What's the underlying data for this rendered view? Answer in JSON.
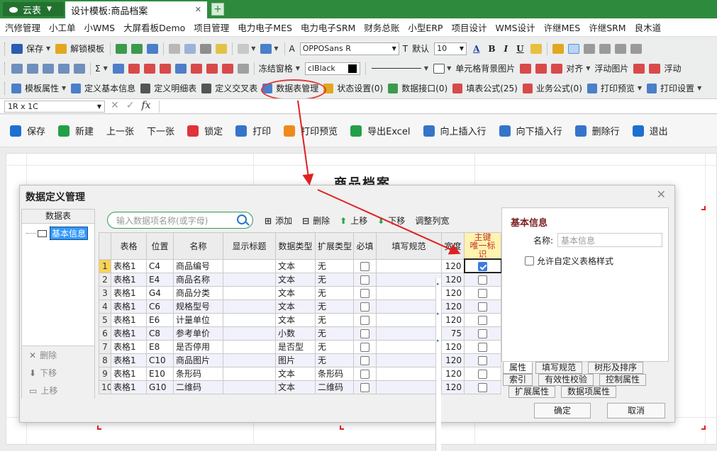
{
  "app": {
    "name": "云表",
    "doc_tab": "设计模板:商品档案"
  },
  "menu": [
    "汽修管理",
    "小工单",
    "小WMS",
    "大屏看板Demo",
    "项目管理",
    "电力电子MES",
    "电力电子SRM",
    "财务总账",
    "小型ERP",
    "项目设计",
    "WMS设计",
    "许继MES",
    "许继SRM",
    "良木道"
  ],
  "toolbar1": {
    "save": "保存",
    "unlock": "解锁模板",
    "font": "OPPOSans R",
    "theme": "默认",
    "size": "10"
  },
  "toolbar2": {
    "freeze": "冻结窗格",
    "color": "clBlack",
    "cell_bg": "单元格背景图片",
    "align": "对齐",
    "float_img": "浮动图片",
    "float2": "浮动"
  },
  "toolbar3": [
    "模板属性",
    "定义基本信息",
    "定义明细表",
    "定义交叉表",
    "数据表管理",
    "状态设置(0)",
    "数据接口(0)",
    "填表公式(25)",
    "业务公式(0)",
    "打印预览",
    "打印设置"
  ],
  "formula": {
    "cellref": "1R x 1C"
  },
  "big_toolbar": [
    "保存",
    "新建",
    "上一张",
    "下一张",
    "锁定",
    "打印",
    "打印预览",
    "导出Excel",
    "向上插入行",
    "向下插入行",
    "删除行",
    "退出"
  ],
  "sheet": {
    "title": "商品档案"
  },
  "dialog": {
    "title": "数据定义管理",
    "left": {
      "header": "数据表",
      "node": "基本信息",
      "actions": [
        "删除",
        "下移",
        "上移"
      ]
    },
    "search_placeholder": "输入数据项名称(或字母)",
    "buttons": [
      "添加",
      "删除",
      "上移",
      "下移",
      "调整列宽"
    ],
    "columns": [
      "表格",
      "位置",
      "名称",
      "显示标题",
      "数据类型",
      "扩展类型",
      "必填",
      "填写规范",
      "宽度",
      "主键\n唯一标识"
    ],
    "rows": [
      {
        "n": "1",
        "t": "表格1",
        "p": "C4",
        "name": "商品编号",
        "type": "文本",
        "ext": "无",
        "w": "120",
        "pk": true
      },
      {
        "n": "2",
        "t": "表格1",
        "p": "E4",
        "name": "商品名称",
        "type": "文本",
        "ext": "无",
        "w": "120",
        "pk": false
      },
      {
        "n": "3",
        "t": "表格1",
        "p": "G4",
        "name": "商品分类",
        "type": "文本",
        "ext": "无",
        "w": "120",
        "pk": false
      },
      {
        "n": "4",
        "t": "表格1",
        "p": "C6",
        "name": "规格型号",
        "type": "文本",
        "ext": "无",
        "w": "120",
        "pk": false
      },
      {
        "n": "5",
        "t": "表格1",
        "p": "E6",
        "name": "计量单位",
        "type": "文本",
        "ext": "无",
        "w": "120",
        "pk": false
      },
      {
        "n": "6",
        "t": "表格1",
        "p": "C8",
        "name": "参考单价",
        "type": "小数",
        "ext": "无",
        "w": "75",
        "pk": false
      },
      {
        "n": "7",
        "t": "表格1",
        "p": "E8",
        "name": "是否停用",
        "type": "是否型",
        "ext": "无",
        "w": "120",
        "pk": false
      },
      {
        "n": "8",
        "t": "表格1",
        "p": "C10",
        "name": "商品图片",
        "type": "图片",
        "ext": "无",
        "w": "120",
        "pk": false
      },
      {
        "n": "9",
        "t": "表格1",
        "p": "E10",
        "name": "条形码",
        "type": "文本",
        "ext": "条形码",
        "w": "120",
        "pk": false
      },
      {
        "n": "10",
        "t": "表格1",
        "p": "G10",
        "name": "二维码",
        "type": "文本",
        "ext": "二维码",
        "w": "120",
        "pk": false
      }
    ],
    "props": {
      "title": "基本信息",
      "name_label": "名称:",
      "name_placeholder": "基本信息",
      "custom_style": "允许自定义表格样式"
    },
    "tabs": [
      "属性",
      "填写规范",
      "树形及排序",
      "索引",
      "有效性校验",
      "控制属性",
      "扩展属性",
      "数据项属性"
    ],
    "ok": "确定",
    "cancel": "取消"
  }
}
